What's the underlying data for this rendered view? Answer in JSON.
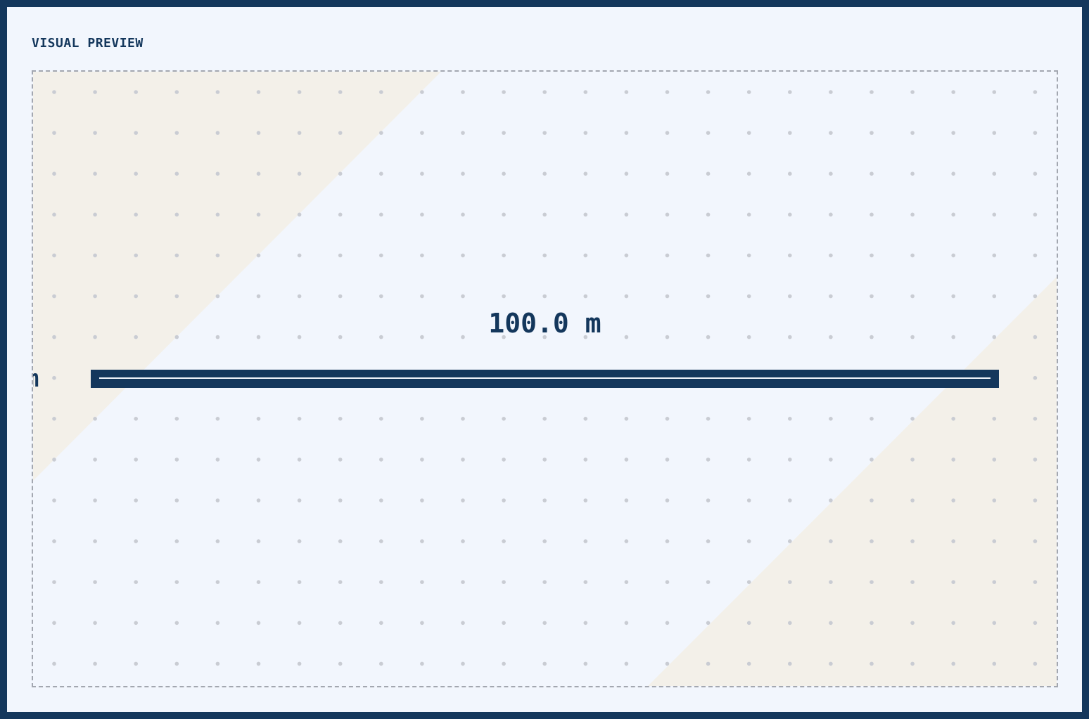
{
  "panel": {
    "title": "VISUAL PREVIEW"
  },
  "scale": {
    "label": "100.0 m",
    "left_unit_fragment": "m"
  },
  "colors": {
    "frame": "#14375c",
    "background": "#f2f6fd",
    "accent_beige": "#f3f0e9",
    "dot": "#c9ccd3",
    "border_dashed": "#a3a7b0"
  }
}
